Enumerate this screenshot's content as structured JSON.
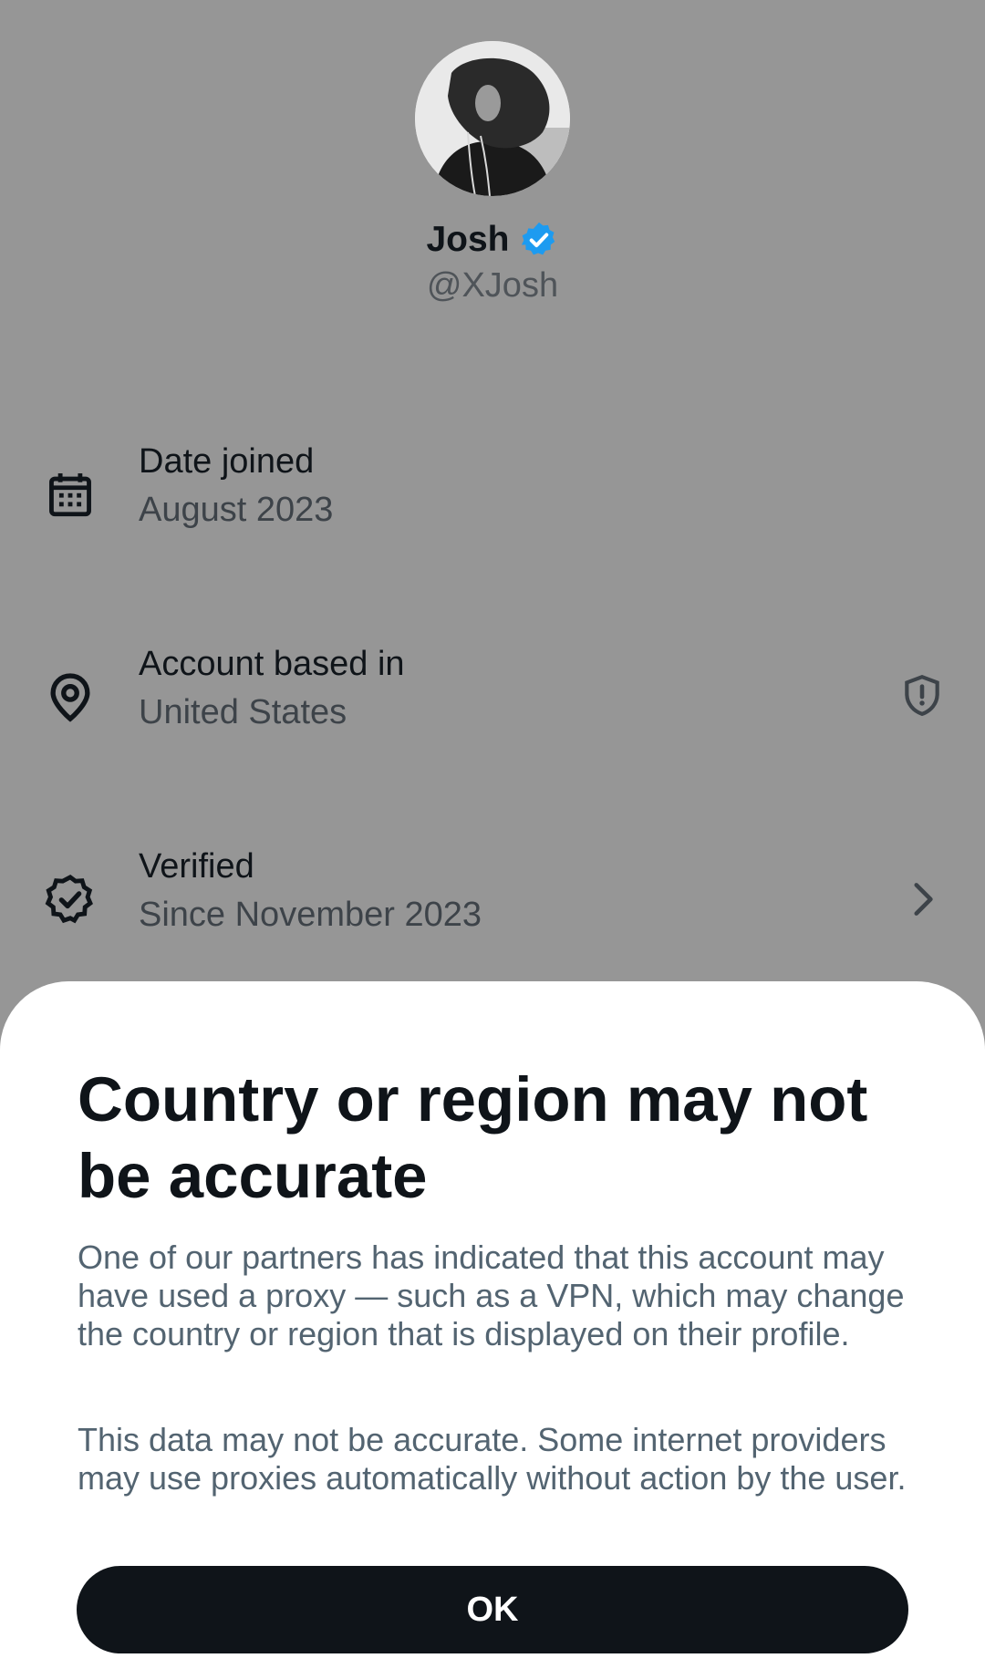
{
  "profile": {
    "name": "Josh",
    "handle": "@XJosh",
    "verified_badge_icon": "verified-badge-icon",
    "badge_color": "#1d9bf0"
  },
  "info": {
    "joined": {
      "icon": "calendar-icon",
      "title": "Date joined",
      "value": "August 2023"
    },
    "location": {
      "icon": "location-pin-icon",
      "title": "Account based in",
      "value": "United States",
      "trailing_icon": "shield-alert-icon"
    },
    "verified": {
      "icon": "verified-outline-icon",
      "title": "Verified",
      "value": "Since November 2023",
      "trailing_icon": "chevron-right-icon"
    }
  },
  "sheet": {
    "title": "Country or region may not be accurate",
    "paragraph1": "One of our partners has indicated that this account may have used a proxy — such as a VPN, which may change the country or region that is displayed on their profile.",
    "paragraph2": "This data may not be accurate. Some internet providers may use proxies automatically without action by the user.",
    "ok_label": "OK"
  },
  "colors": {
    "overlay_background": "#969696",
    "text_primary": "#0f1419",
    "text_secondary": "#536471",
    "button_background": "#0f1419",
    "button_text": "#ffffff"
  }
}
